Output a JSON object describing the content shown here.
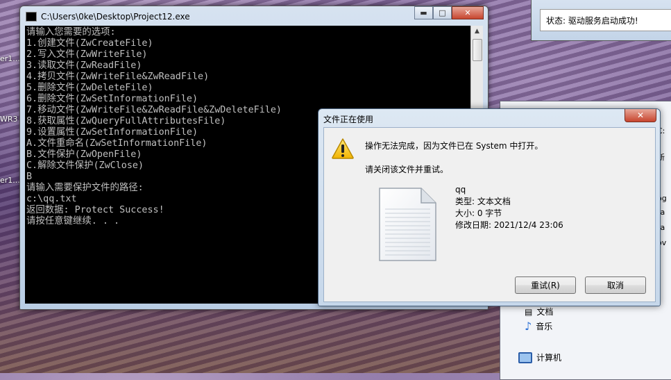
{
  "desktop": {
    "labels": [
      "er1...",
      "WR3",
      "er1..."
    ]
  },
  "console": {
    "title": "C:\\Users\\0ke\\Desktop\\Project12.exe",
    "min": "▬",
    "max": "□",
    "close": "✕",
    "lines": [
      "请输入您需要的选项:",
      "1.创建文件(ZwCreateFile)",
      "2.写入文件(ZwWriteFile)",
      "3.读取文件(ZwReadFile)",
      "4.拷贝文件(ZwWriteFile&ZwReadFile)",
      "5.删除文件(ZwDeleteFile)",
      "6.删除文件(ZwSetInformationFile)",
      "7.移动文件(ZwWriteFile&ZwReadFile&ZwDeleteFile)",
      "8.获取属性(ZwQueryFullAttributesFile)",
      "9.设置属性(ZwSetInformationFile)",
      "A.文件重命名(ZwSetInformationFile)",
      "B.文件保护(ZwOpenFile)",
      "C.解除文件保护(ZwClose)",
      "B",
      "请输入需要保护文件的路径:",
      "c:\\qq.txt",
      "返回数据: Protect Success!",
      "请按任意键继续. . ."
    ]
  },
  "status_window": {
    "text": "状态: 驱动服务启动成功!"
  },
  "explorer": {
    "item_documents": "文档",
    "item_music": "音乐",
    "item_computer": "计算机",
    "fragments": [
      "C:",
      "新",
      "og",
      "ra",
      "ra",
      "ov"
    ]
  },
  "dialog": {
    "title": "文件正在使用",
    "close": "✕",
    "message": "操作无法完成，因为文件已在 System 中打开。",
    "instruction": "请关闭该文件并重试。",
    "file_name": "qq",
    "file_type": "类型: 文本文档",
    "file_size": "大小: 0 字节",
    "file_modified": "修改日期: 2021/12/4 23:06",
    "retry_button": "重试(R)",
    "cancel_button": "取消"
  }
}
